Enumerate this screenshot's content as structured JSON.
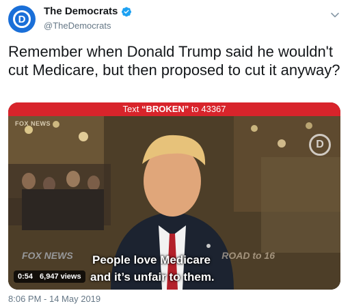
{
  "author": {
    "display_name": "The Democrats",
    "handle": "@TheDemocrats",
    "avatar_letter": "D",
    "verified": true,
    "accent_color": "#1a6fd8"
  },
  "tweet": {
    "text": "Remember when Donald Trump said he wouldn't cut Medicare, but then proposed to cut it anyway?",
    "timestamp": "8:06 PM - 14 May 2019"
  },
  "video": {
    "banner_prefix": "Text ",
    "banner_keyword": "“BROKEN”",
    "banner_suffix": " to 43367",
    "banner_color": "#d8242b",
    "top_left_bug": "FOX NEWS",
    "watermark_letter": "D",
    "caption_line1": "People love Medicare",
    "caption_line2": "and it’s unfair to them.",
    "duration": "0:54",
    "views": "6,947 views",
    "lower_left_bug": "FOX NEWS",
    "lower_right_bug": "ROAD to 16"
  },
  "icons": {
    "verified": "verified-badge-icon",
    "menu": "chevron-down-icon"
  }
}
